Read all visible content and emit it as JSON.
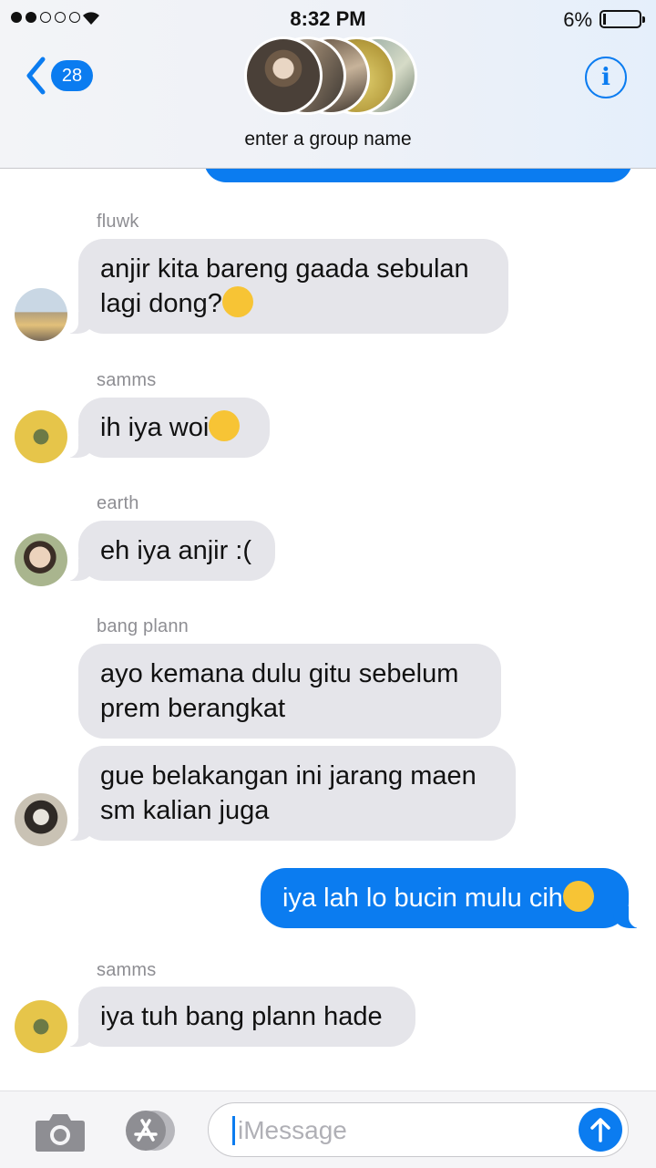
{
  "status_bar": {
    "time": "8:32 PM",
    "battery_percent": "6%",
    "signal_bars_filled": 2,
    "signal_bars_total": 5,
    "battery_level": 0.06
  },
  "header": {
    "back_count": "28",
    "group_name": "enter a group name",
    "info_label": "i"
  },
  "messages": [
    {
      "sender": "fluwk",
      "text_line1": "anjir kita bareng gaada sebulan",
      "text_line2": "lagi dong?",
      "emoji": "loudly-crying-face"
    },
    {
      "sender": "samms",
      "text": "ih iya woi",
      "emoji": "loudly-crying-face"
    },
    {
      "sender": "earth",
      "text": "eh iya anjir :("
    },
    {
      "sender": "bang plann",
      "text_line1": "ayo kemana dulu gitu sebelum",
      "text_line2": "prem berangkat"
    },
    {
      "sender": "bang plann",
      "text_line1": "gue belakangan ini jarang maen",
      "text_line2": "sm kalian juga"
    },
    {
      "sender": "me",
      "text": "iya lah lo bucin mulu cih",
      "emoji": "unamused-face"
    },
    {
      "sender": "samms",
      "text": "iya tuh bang plann hade"
    }
  ],
  "input": {
    "placeholder": "iMessage"
  },
  "colors": {
    "accent": "#0b7cf0",
    "incoming_bubble": "#e5e5ea",
    "outgoing_bubble": "#0b7cf0"
  }
}
